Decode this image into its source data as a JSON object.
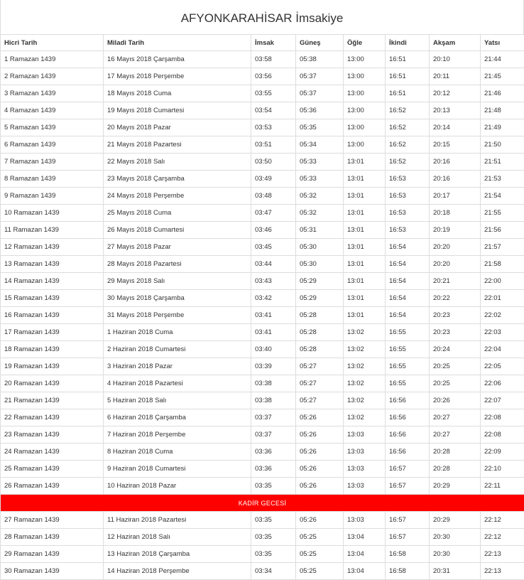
{
  "title": "AFYONKARAHİSAR İmsakiye",
  "columns": [
    "Hicri Tarih",
    "Miladi Tarih",
    "İmsak",
    "Güneş",
    "Öğle",
    "İkindi",
    "Akşam",
    "Yatsı"
  ],
  "rows": [
    {
      "hicri": "1 Ramazan 1439",
      "miladi": "16 Mayıs 2018 Çarşamba",
      "imsak": "03:58",
      "gunes": "05:38",
      "ogle": "13:00",
      "ikindi": "16:51",
      "aksam": "20:10",
      "yatsi": "21:44"
    },
    {
      "hicri": "2 Ramazan 1439",
      "miladi": "17 Mayıs 2018 Perşembe",
      "imsak": "03:56",
      "gunes": "05:37",
      "ogle": "13:00",
      "ikindi": "16:51",
      "aksam": "20:11",
      "yatsi": "21:45"
    },
    {
      "hicri": "3 Ramazan 1439",
      "miladi": "18 Mayıs 2018 Cuma",
      "imsak": "03:55",
      "gunes": "05:37",
      "ogle": "13:00",
      "ikindi": "16:51",
      "aksam": "20:12",
      "yatsi": "21:46"
    },
    {
      "hicri": "4 Ramazan 1439",
      "miladi": "19 Mayıs 2018 Cumartesi",
      "imsak": "03:54",
      "gunes": "05:36",
      "ogle": "13:00",
      "ikindi": "16:52",
      "aksam": "20:13",
      "yatsi": "21:48"
    },
    {
      "hicri": "5 Ramazan 1439",
      "miladi": "20 Mayıs 2018 Pazar",
      "imsak": "03:53",
      "gunes": "05:35",
      "ogle": "13:00",
      "ikindi": "16:52",
      "aksam": "20:14",
      "yatsi": "21:49"
    },
    {
      "hicri": "6 Ramazan 1439",
      "miladi": "21 Mayıs 2018 Pazartesi",
      "imsak": "03:51",
      "gunes": "05:34",
      "ogle": "13:00",
      "ikindi": "16:52",
      "aksam": "20:15",
      "yatsi": "21:50"
    },
    {
      "hicri": "7 Ramazan 1439",
      "miladi": "22 Mayıs 2018 Salı",
      "imsak": "03:50",
      "gunes": "05:33",
      "ogle": "13:01",
      "ikindi": "16:52",
      "aksam": "20:16",
      "yatsi": "21:51"
    },
    {
      "hicri": "8 Ramazan 1439",
      "miladi": "23 Mayıs 2018 Çarşamba",
      "imsak": "03:49",
      "gunes": "05:33",
      "ogle": "13:01",
      "ikindi": "16:53",
      "aksam": "20:16",
      "yatsi": "21:53"
    },
    {
      "hicri": "9 Ramazan 1439",
      "miladi": "24 Mayıs 2018 Perşembe",
      "imsak": "03:48",
      "gunes": "05:32",
      "ogle": "13:01",
      "ikindi": "16:53",
      "aksam": "20:17",
      "yatsi": "21:54"
    },
    {
      "hicri": "10 Ramazan 1439",
      "miladi": "25 Mayıs 2018 Cuma",
      "imsak": "03:47",
      "gunes": "05:32",
      "ogle": "13:01",
      "ikindi": "16:53",
      "aksam": "20:18",
      "yatsi": "21:55"
    },
    {
      "hicri": "11 Ramazan 1439",
      "miladi": "26 Mayıs 2018 Cumartesi",
      "imsak": "03:46",
      "gunes": "05:31",
      "ogle": "13:01",
      "ikindi": "16:53",
      "aksam": "20:19",
      "yatsi": "21:56"
    },
    {
      "hicri": "12 Ramazan 1439",
      "miladi": "27 Mayıs 2018 Pazar",
      "imsak": "03:45",
      "gunes": "05:30",
      "ogle": "13:01",
      "ikindi": "16:54",
      "aksam": "20:20",
      "yatsi": "21:57"
    },
    {
      "hicri": "13 Ramazan 1439",
      "miladi": "28 Mayıs 2018 Pazartesi",
      "imsak": "03:44",
      "gunes": "05:30",
      "ogle": "13:01",
      "ikindi": "16:54",
      "aksam": "20:20",
      "yatsi": "21:58"
    },
    {
      "hicri": "14 Ramazan 1439",
      "miladi": "29 Mayıs 2018 Salı",
      "imsak": "03:43",
      "gunes": "05:29",
      "ogle": "13:01",
      "ikindi": "16:54",
      "aksam": "20:21",
      "yatsi": "22:00"
    },
    {
      "hicri": "15 Ramazan 1439",
      "miladi": "30 Mayıs 2018 Çarşamba",
      "imsak": "03:42",
      "gunes": "05:29",
      "ogle": "13:01",
      "ikindi": "16:54",
      "aksam": "20:22",
      "yatsi": "22:01"
    },
    {
      "hicri": "16 Ramazan 1439",
      "miladi": "31 Mayıs 2018 Perşembe",
      "imsak": "03:41",
      "gunes": "05:28",
      "ogle": "13:01",
      "ikindi": "16:54",
      "aksam": "20:23",
      "yatsi": "22:02"
    },
    {
      "hicri": "17 Ramazan 1439",
      "miladi": "1 Haziran 2018 Cuma",
      "imsak": "03:41",
      "gunes": "05:28",
      "ogle": "13:02",
      "ikindi": "16:55",
      "aksam": "20:23",
      "yatsi": "22:03"
    },
    {
      "hicri": "18 Ramazan 1439",
      "miladi": "2 Haziran 2018 Cumartesi",
      "imsak": "03:40",
      "gunes": "05:28",
      "ogle": "13:02",
      "ikindi": "16:55",
      "aksam": "20:24",
      "yatsi": "22:04"
    },
    {
      "hicri": "19 Ramazan 1439",
      "miladi": "3 Haziran 2018 Pazar",
      "imsak": "03:39",
      "gunes": "05:27",
      "ogle": "13:02",
      "ikindi": "16:55",
      "aksam": "20:25",
      "yatsi": "22:05"
    },
    {
      "hicri": "20 Ramazan 1439",
      "miladi": "4 Haziran 2018 Pazartesi",
      "imsak": "03:38",
      "gunes": "05:27",
      "ogle": "13:02",
      "ikindi": "16:55",
      "aksam": "20:25",
      "yatsi": "22:06"
    },
    {
      "hicri": "21 Ramazan 1439",
      "miladi": "5 Haziran 2018 Salı",
      "imsak": "03:38",
      "gunes": "05:27",
      "ogle": "13:02",
      "ikindi": "16:56",
      "aksam": "20:26",
      "yatsi": "22:07"
    },
    {
      "hicri": "22 Ramazan 1439",
      "miladi": "6 Haziran 2018 Çarşamba",
      "imsak": "03:37",
      "gunes": "05:26",
      "ogle": "13:02",
      "ikindi": "16:56",
      "aksam": "20:27",
      "yatsi": "22:08"
    },
    {
      "hicri": "23 Ramazan 1439",
      "miladi": "7 Haziran 2018 Perşembe",
      "imsak": "03:37",
      "gunes": "05:26",
      "ogle": "13:03",
      "ikindi": "16:56",
      "aksam": "20:27",
      "yatsi": "22:08"
    },
    {
      "hicri": "24 Ramazan 1439",
      "miladi": "8 Haziran 2018 Cuma",
      "imsak": "03:36",
      "gunes": "05:26",
      "ogle": "13:03",
      "ikindi": "16:56",
      "aksam": "20:28",
      "yatsi": "22:09"
    },
    {
      "hicri": "25 Ramazan 1439",
      "miladi": "9 Haziran 2018 Cumartesi",
      "imsak": "03:36",
      "gunes": "05:26",
      "ogle": "13:03",
      "ikindi": "16:57",
      "aksam": "20:28",
      "yatsi": "22:10"
    },
    {
      "hicri": "26 Ramazan 1439",
      "miladi": "10 Haziran 2018 Pazar",
      "imsak": "03:35",
      "gunes": "05:26",
      "ogle": "13:03",
      "ikindi": "16:57",
      "aksam": "20:29",
      "yatsi": "22:11"
    },
    {
      "special": "KADİR GECESİ"
    },
    {
      "hicri": "27 Ramazan 1439",
      "miladi": "11 Haziran 2018 Pazartesi",
      "imsak": "03:35",
      "gunes": "05:26",
      "ogle": "13:03",
      "ikindi": "16:57",
      "aksam": "20:29",
      "yatsi": "22:12"
    },
    {
      "hicri": "28 Ramazan 1439",
      "miladi": "12 Haziran 2018 Salı",
      "imsak": "03:35",
      "gunes": "05:25",
      "ogle": "13:04",
      "ikindi": "16:57",
      "aksam": "20:30",
      "yatsi": "22:12"
    },
    {
      "hicri": "29 Ramazan 1439",
      "miladi": "13 Haziran 2018 Çarşamba",
      "imsak": "03:35",
      "gunes": "05:25",
      "ogle": "13:04",
      "ikindi": "16:58",
      "aksam": "20:30",
      "yatsi": "22:13"
    },
    {
      "hicri": "30 Ramazan 1439",
      "miladi": "14 Haziran 2018 Perşembe",
      "imsak": "03:34",
      "gunes": "05:25",
      "ogle": "13:04",
      "ikindi": "16:58",
      "aksam": "20:31",
      "yatsi": "22:13"
    }
  ],
  "colors": {
    "special_row_bg": "#ff0000",
    "special_row_text": "#ffffff",
    "border": "#dddddd"
  }
}
